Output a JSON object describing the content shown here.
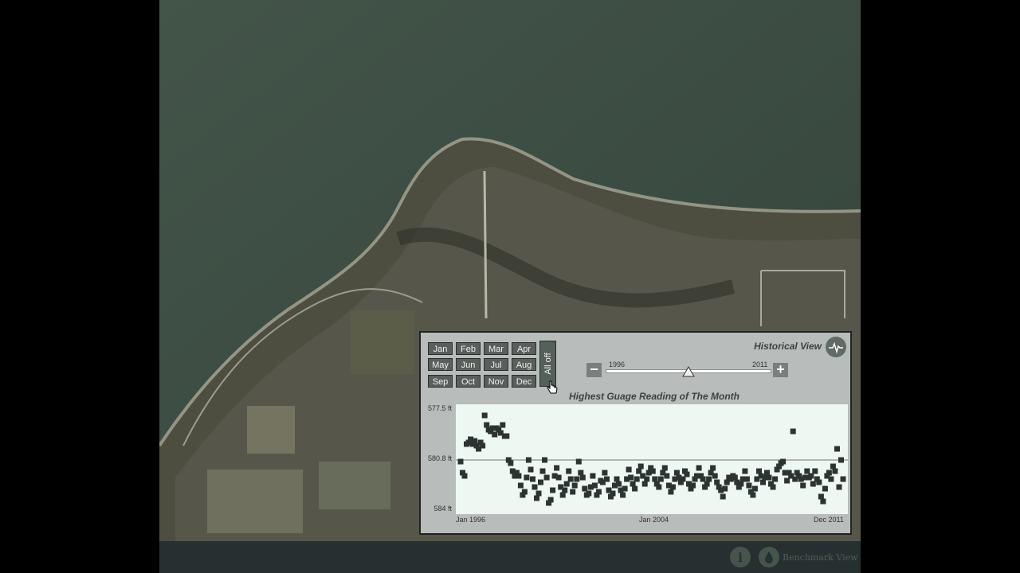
{
  "months": {
    "rows": [
      [
        "Jan",
        "Feb",
        "Mar",
        "Apr"
      ],
      [
        "May",
        "Jun",
        "Jul",
        "Aug"
      ],
      [
        "Sep",
        "Oct",
        "Nov",
        "Dec"
      ]
    ],
    "all_off_label": "All off"
  },
  "header": {
    "title": "Historical View",
    "icon": "waveform-icon"
  },
  "range_slider": {
    "start_label": "1996",
    "end_label": "2011",
    "minus": "−",
    "plus": "+",
    "handle_fraction": 0.5
  },
  "chart_data": {
    "type": "scatter",
    "title": "Highest Guage Reading of The Month",
    "y_tick_labels": [
      "577.5 ft",
      "580.8 ft",
      "584 ft"
    ],
    "y_ticks": [
      577.5,
      580.8,
      584.0
    ],
    "ylim": [
      577.5,
      584.0
    ],
    "y_inverted": true,
    "x_tick_labels": [
      "Jan 1996",
      "Jan 2004",
      "Dec 2011"
    ],
    "xlim": [
      0,
      191
    ],
    "reference_line": 580.8,
    "marker_color": "#2d3331",
    "points": [
      [
        0,
        580.9
      ],
      [
        1,
        581.6
      ],
      [
        2,
        581.8
      ],
      [
        3,
        579.8
      ],
      [
        4,
        579.7
      ],
      [
        5,
        579.5
      ],
      [
        6,
        579.8
      ],
      [
        7,
        579.6
      ],
      [
        8,
        579.9
      ],
      [
        9,
        580.1
      ],
      [
        10,
        579.7
      ],
      [
        11,
        579.9
      ],
      [
        12,
        578.0
      ],
      [
        13,
        578.6
      ],
      [
        14,
        578.9
      ],
      [
        15,
        579.0
      ],
      [
        16,
        578.8
      ],
      [
        17,
        579.2
      ],
      [
        18,
        578.8
      ],
      [
        19,
        578.9
      ],
      [
        20,
        579.1
      ],
      [
        21,
        578.6
      ],
      [
        22,
        579.3
      ],
      [
        23,
        579.3
      ],
      [
        24,
        580.8
      ],
      [
        25,
        581.0
      ],
      [
        26,
        581.5
      ],
      [
        27,
        581.8
      ],
      [
        28,
        581.6
      ],
      [
        29,
        581.8
      ],
      [
        30,
        582.4
      ],
      [
        31,
        583.0
      ],
      [
        32,
        582.8
      ],
      [
        33,
        581.9
      ],
      [
        34,
        580.8
      ],
      [
        35,
        581.4
      ],
      [
        36,
        582.0
      ],
      [
        37,
        582.5
      ],
      [
        38,
        583.2
      ],
      [
        39,
        582.9
      ],
      [
        40,
        582.2
      ],
      [
        41,
        581.5
      ],
      [
        42,
        580.8
      ],
      [
        43,
        581.9
      ],
      [
        44,
        583.5
      ],
      [
        45,
        583.3
      ],
      [
        46,
        582.7
      ],
      [
        47,
        581.8
      ],
      [
        48,
        581.3
      ],
      [
        49,
        581.9
      ],
      [
        50,
        582.5
      ],
      [
        51,
        583.0
      ],
      [
        52,
        582.7
      ],
      [
        53,
        582.3
      ],
      [
        54,
        581.5
      ],
      [
        55,
        582.0
      ],
      [
        56,
        582.8
      ],
      [
        57,
        582.4
      ],
      [
        58,
        582.0
      ],
      [
        59,
        580.9
      ],
      [
        60,
        581.6
      ],
      [
        61,
        581.9
      ],
      [
        62,
        582.6
      ],
      [
        63,
        583.0
      ],
      [
        64,
        582.9
      ],
      [
        65,
        582.5
      ],
      [
        66,
        581.8
      ],
      [
        67,
        582.4
      ],
      [
        68,
        583.0
      ],
      [
        69,
        582.8
      ],
      [
        70,
        582.1
      ],
      [
        71,
        582.2
      ],
      [
        72,
        581.6
      ],
      [
        73,
        582.0
      ],
      [
        74,
        582.7
      ],
      [
        75,
        583.1
      ],
      [
        76,
        582.9
      ],
      [
        77,
        582.4
      ],
      [
        78,
        582.0
      ],
      [
        79,
        582.3
      ],
      [
        80,
        582.7
      ],
      [
        81,
        583.0
      ],
      [
        82,
        582.6
      ],
      [
        83,
        582.0
      ],
      [
        84,
        581.4
      ],
      [
        85,
        581.9
      ],
      [
        86,
        582.3
      ],
      [
        87,
        582.6
      ],
      [
        88,
        582.0
      ],
      [
        89,
        581.5
      ],
      [
        90,
        581.2
      ],
      [
        91,
        581.8
      ],
      [
        92,
        582.3
      ],
      [
        93,
        582.0
      ],
      [
        94,
        581.6
      ],
      [
        95,
        581.3
      ],
      [
        96,
        581.5
      ],
      [
        97,
        582.0
      ],
      [
        98,
        582.3
      ],
      [
        99,
        582.5
      ],
      [
        100,
        582.0
      ],
      [
        101,
        581.6
      ],
      [
        102,
        581.3
      ],
      [
        103,
        581.8
      ],
      [
        104,
        582.4
      ],
      [
        105,
        582.8
      ],
      [
        106,
        582.5
      ],
      [
        107,
        582.0
      ],
      [
        108,
        581.6
      ],
      [
        109,
        581.9
      ],
      [
        110,
        582.2
      ],
      [
        111,
        582.0
      ],
      [
        112,
        581.5
      ],
      [
        113,
        581.7
      ],
      [
        114,
        582.3
      ],
      [
        115,
        582.6
      ],
      [
        116,
        582.4
      ],
      [
        117,
        582.0
      ],
      [
        118,
        581.8
      ],
      [
        119,
        581.3
      ],
      [
        120,
        581.8
      ],
      [
        121,
        582.0
      ],
      [
        122,
        582.5
      ],
      [
        123,
        582.3
      ],
      [
        124,
        582.0
      ],
      [
        125,
        581.6
      ],
      [
        126,
        581.3
      ],
      [
        127,
        581.8
      ],
      [
        128,
        582.2
      ],
      [
        129,
        582.5
      ],
      [
        130,
        582.7
      ],
      [
        131,
        583.1
      ],
      [
        132,
        582.6
      ],
      [
        133,
        582.2
      ],
      [
        134,
        581.9
      ],
      [
        135,
        582.0
      ],
      [
        136,
        581.8
      ],
      [
        137,
        581.9
      ],
      [
        138,
        582.2
      ],
      [
        139,
        582.5
      ],
      [
        140,
        582.3
      ],
      [
        141,
        582.0
      ],
      [
        142,
        581.5
      ],
      [
        143,
        582.0
      ],
      [
        144,
        582.4
      ],
      [
        145,
        582.8
      ],
      [
        146,
        583.0
      ],
      [
        147,
        582.6
      ],
      [
        148,
        582.0
      ],
      [
        149,
        581.5
      ],
      [
        150,
        581.8
      ],
      [
        151,
        582.2
      ],
      [
        152,
        581.9
      ],
      [
        153,
        581.6
      ],
      [
        154,
        581.9
      ],
      [
        155,
        582.3
      ],
      [
        156,
        582.5
      ],
      [
        157,
        582.0
      ],
      [
        158,
        581.4
      ],
      [
        159,
        581.2
      ],
      [
        160,
        581.0
      ],
      [
        161,
        580.9
      ],
      [
        162,
        581.6
      ],
      [
        163,
        582.1
      ],
      [
        164,
        581.6
      ],
      [
        165,
        581.8
      ],
      [
        166,
        579.0
      ],
      [
        167,
        582.0
      ],
      [
        168,
        581.6
      ],
      [
        169,
        581.8
      ],
      [
        170,
        582.0
      ],
      [
        171,
        582.4
      ],
      [
        172,
        581.9
      ],
      [
        173,
        581.5
      ],
      [
        174,
        581.9
      ],
      [
        175,
        581.8
      ],
      [
        176,
        582.3
      ],
      [
        177,
        581.5
      ],
      [
        178,
        582.0
      ],
      [
        179,
        582.2
      ],
      [
        180,
        583.1
      ],
      [
        181,
        583.4
      ],
      [
        182,
        582.6
      ],
      [
        183,
        581.8
      ],
      [
        184,
        581.6
      ],
      [
        185,
        582.0
      ],
      [
        186,
        581.2
      ],
      [
        187,
        581.5
      ],
      [
        188,
        580.1
      ],
      [
        189,
        582.5
      ],
      [
        190,
        580.8
      ],
      [
        191,
        582.0
      ]
    ]
  },
  "footer": {
    "info_icon": "info-icon",
    "info_glyph": "i",
    "benchmark_icon": "water-drop-icon",
    "benchmark_label": "Benchmark View"
  },
  "colors": {
    "panel_bg": "#b8bcba",
    "button_bg": "#5a5f5c",
    "plot_bg": "#eef8f3",
    "water": "#3b4b42"
  }
}
